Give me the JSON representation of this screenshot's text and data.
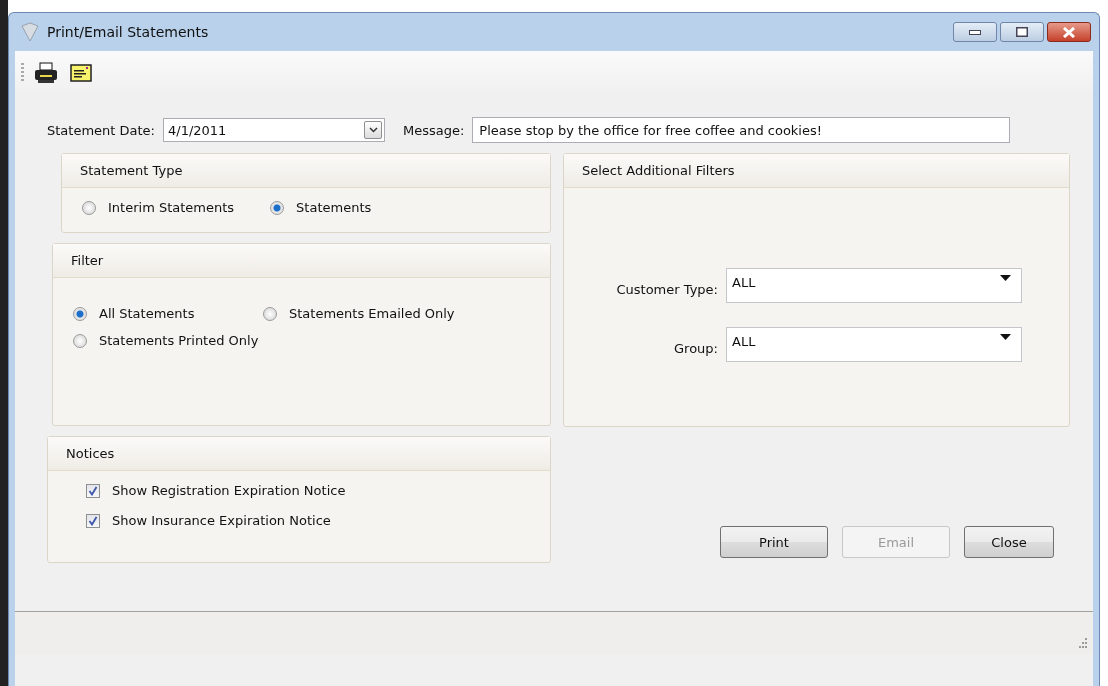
{
  "window": {
    "title": "Print/Email Statements"
  },
  "statement_date": {
    "label": "Statement Date:",
    "value": "4/1/2011"
  },
  "message": {
    "label": "Message:",
    "value": "Please stop by the office for free coffee and cookies!"
  },
  "statement_type": {
    "title": "Statement Type",
    "options": [
      {
        "label": "Interim Statements",
        "selected": false
      },
      {
        "label": "Statements",
        "selected": true
      }
    ]
  },
  "filter": {
    "title": "Filter",
    "options": [
      {
        "label": "All Statements",
        "selected": true
      },
      {
        "label": "Statements Emailed Only",
        "selected": false
      },
      {
        "label": "Statements Printed Only",
        "selected": false
      }
    ]
  },
  "notices": {
    "title": "Notices",
    "items": [
      {
        "label": "Show Registration Expiration Notice",
        "checked": true
      },
      {
        "label": "Show Insurance Expiration Notice",
        "checked": true
      }
    ]
  },
  "additional_filters": {
    "title": "Select Additional Filters",
    "fields": [
      {
        "label": "Customer Type:",
        "value": "ALL"
      },
      {
        "label": "Group:",
        "value": "ALL"
      }
    ]
  },
  "buttons": [
    {
      "label": "Print",
      "disabled": false
    },
    {
      "label": "Email",
      "disabled": true
    },
    {
      "label": "Close",
      "disabled": false
    }
  ]
}
